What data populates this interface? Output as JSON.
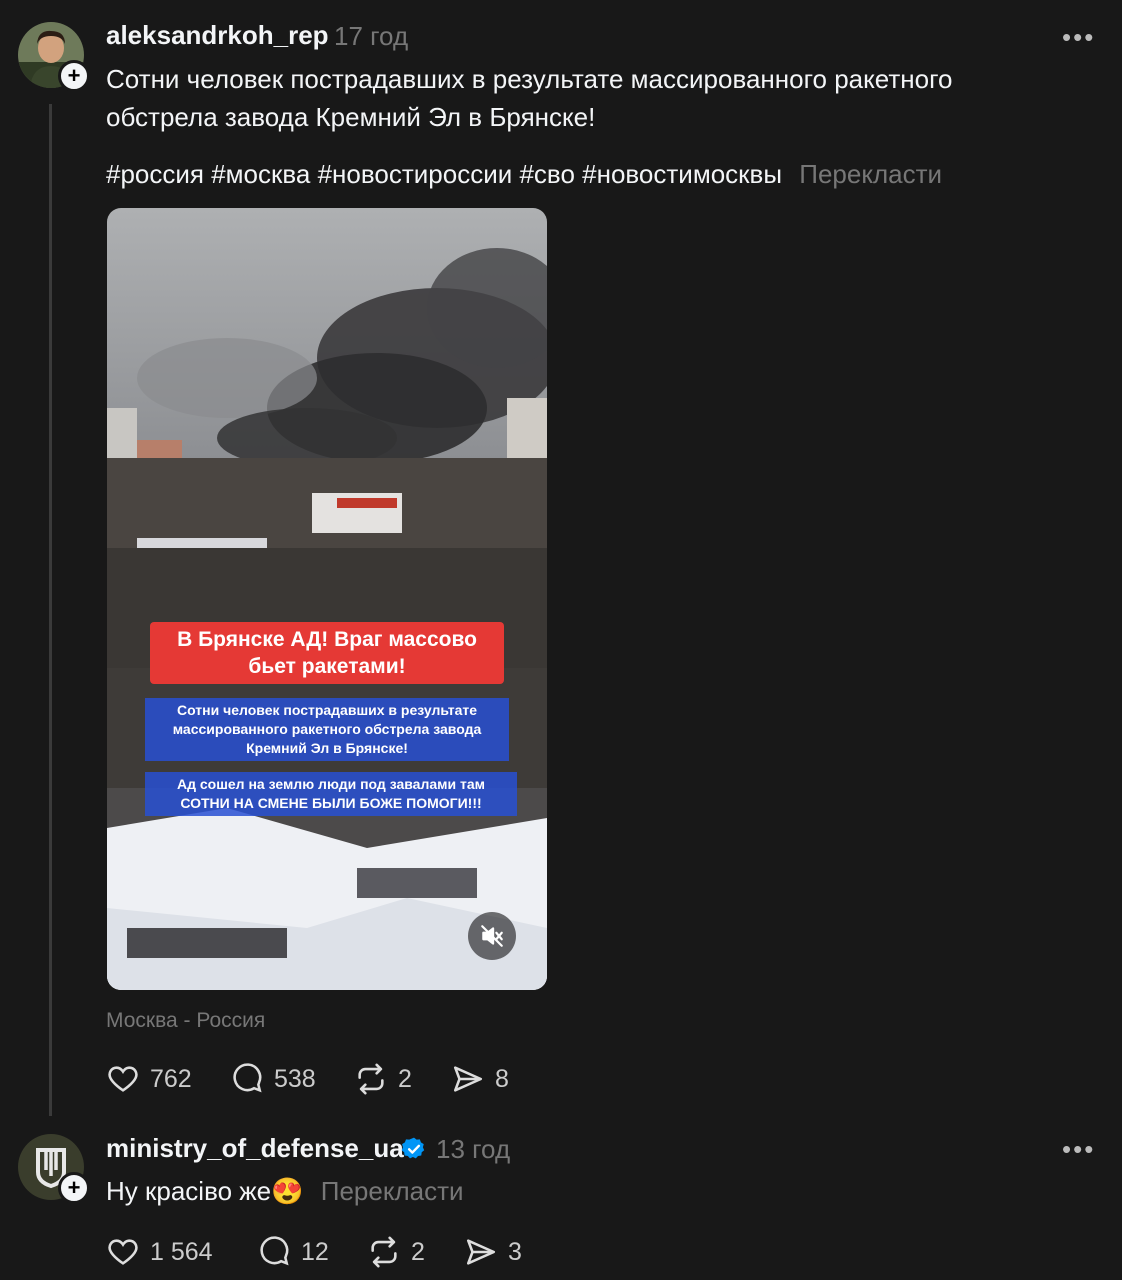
{
  "post": {
    "username": "aleksandrkoh_rep",
    "time": "17 год",
    "text": "Сотни человек пострадавших в результате массированного ракетного обстрела завода Кремний Эл в Брянске!",
    "hashtags": "#россия #москва #новостироссии #сво #новостимосквы",
    "translate_label": "Перекласти",
    "media": {
      "banner_title": "В Брянске АД! Враг массово бьет ракетами!",
      "caption_1": "Сотни человек пострадавших в результате массированного ракетного обстрела завода Кремний Эл в Брянске!",
      "caption_2": "Ад сошел на землю люди под завалами там СОТНИ НА СМЕНЕ БЫЛИ БОЖЕ ПОМОГИ!!!",
      "mute_icon": "speaker-muted-icon"
    },
    "location": "Москва - Россия",
    "stats": {
      "likes": "762",
      "comments": "538",
      "reposts": "2",
      "shares": "8"
    }
  },
  "reply": {
    "username": "ministry_of_defense_ua",
    "verified": true,
    "time": "13 год",
    "text": "Ну красіво же😍",
    "translate_label": "Перекласти",
    "stats": {
      "likes": "1 564",
      "comments": "12",
      "reposts": "2",
      "shares": "3"
    }
  },
  "more_label": "•••",
  "colors": {
    "background": "#181818",
    "text": "#f3f5f7",
    "muted": "#777777",
    "verified": "#0095f6",
    "banner_red": "#e53935"
  }
}
